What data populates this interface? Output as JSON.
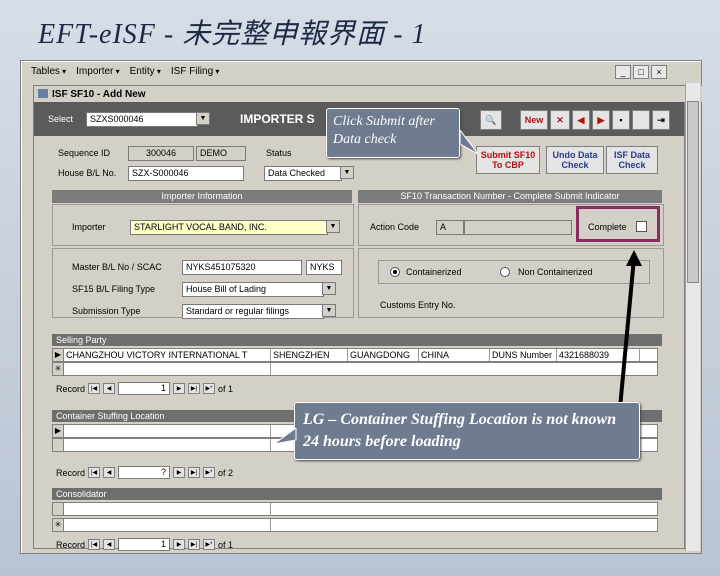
{
  "slide": {
    "title": "EFT-eISF - 未完整申報界面 - 1"
  },
  "menu": {
    "items": [
      "Tables",
      "Importer",
      "Entity",
      "ISF Filing"
    ]
  },
  "form": {
    "title": "ISF SF10 - Add New",
    "select_label": "Select",
    "select_value": "SZXS000046",
    "header_text": "IMPORTER S",
    "toolbar": {
      "new": "New",
      "submit": "Submit SF10 To CBP",
      "undo": "Undo Data Check",
      "isf": "ISF Data Check"
    },
    "sequence_label": "Sequence ID",
    "sequence_value": "300046",
    "sequence_status": "DEMO",
    "house_label": "House B/L No.",
    "house_value": "SZX-S000046",
    "status_label": "Status",
    "status_value": "Data Checked"
  },
  "importer_section": {
    "head": "Importer Information",
    "importer_label": "Importer",
    "importer_value": "STARLIGHT VOCAL BAND, INC.",
    "mbl_label": "Master B/L No / SCAC",
    "mbl_value": "NYKS451075320",
    "scac_value": "NYKS",
    "filing_label": "SF15 B/L Filing Type",
    "filing_value": "House Bill of Lading",
    "submission_label": "Submission Type",
    "submission_value": "Standard or regular filings"
  },
  "sf10_section": {
    "head": "SF10 Transaction Number - Complete Submit Indicator",
    "action_label": "Action Code",
    "action_value": "A",
    "complete_label": "Complete",
    "containerized": "Containerized",
    "non_containerized": "Non Containerized",
    "customs_label": "Customs Entry No."
  },
  "selling_party": {
    "head": "Selling Party",
    "row": [
      "CHANGZHOU VICTORY INTERNATIONAL T",
      "SHENGZHEN",
      "GUANGDONG",
      "CHINA",
      "DUNS Number",
      "4321688039"
    ],
    "record_label": "Record",
    "record_num": "1",
    "of_text": "of 1"
  },
  "stuffing": {
    "head": "Container Stuffing Location",
    "record_label": "Record",
    "record_num": "?",
    "of_text": "of 2"
  },
  "consolidator": {
    "head": "Consolidator",
    "record_label": "Record",
    "record_num": "1",
    "of_text": "of 1"
  },
  "callouts": {
    "submit": "Click Submit after Data check",
    "lg": "LG – Container Stuffing Location is not known 24 hours before loading"
  }
}
